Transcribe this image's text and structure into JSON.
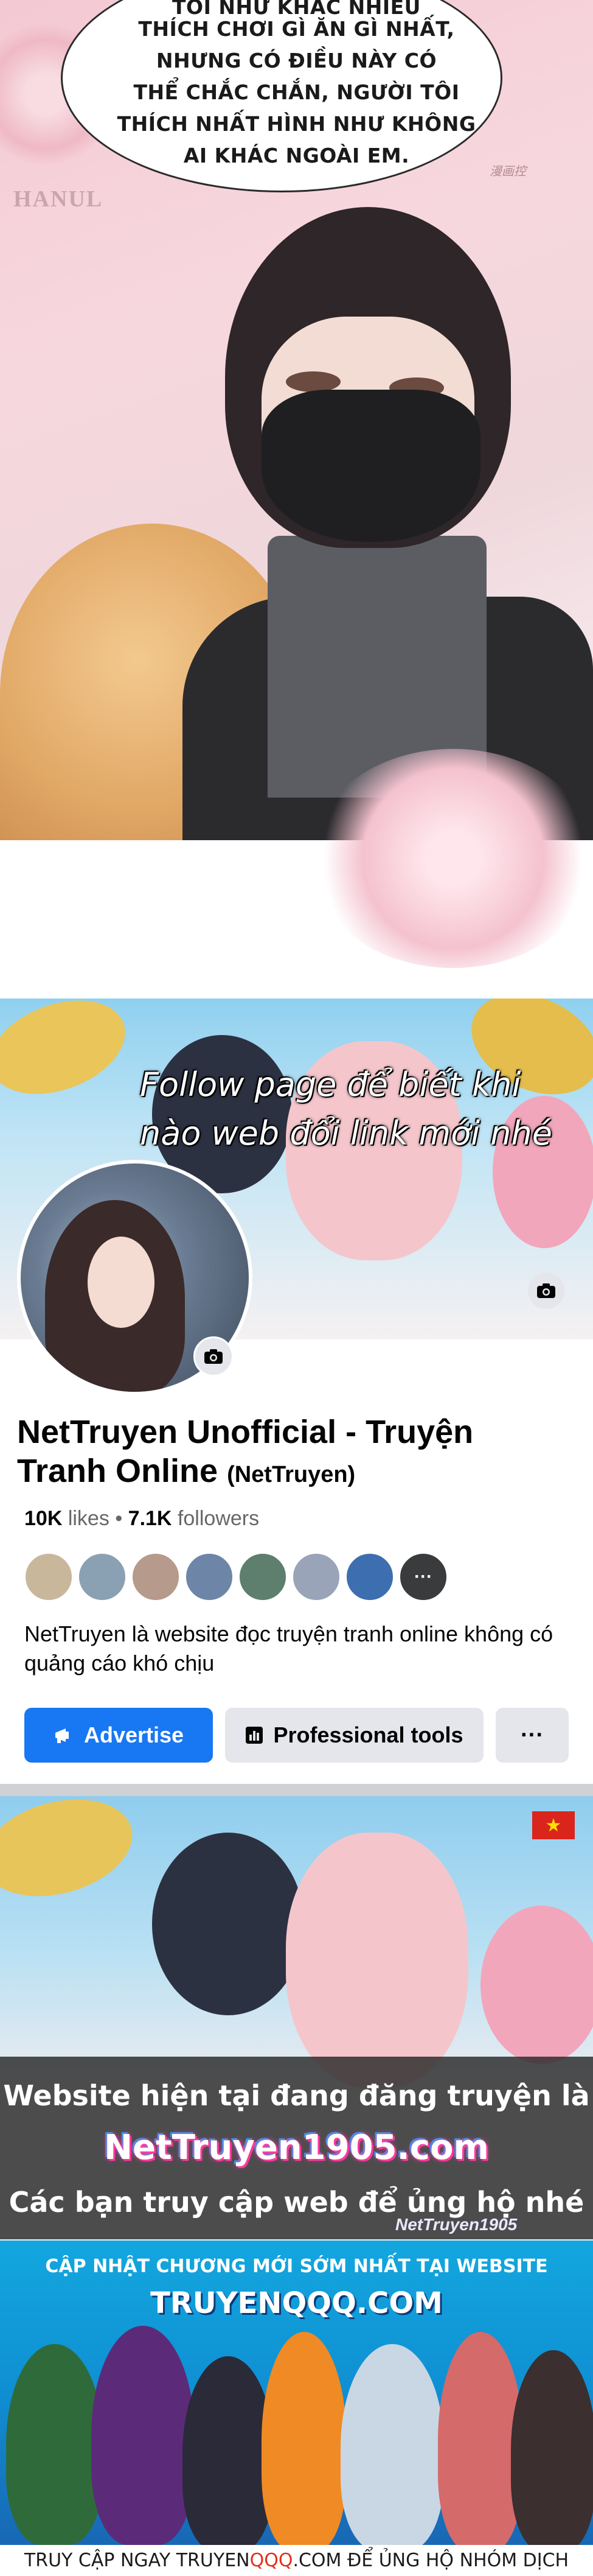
{
  "manga_panel": {
    "speech_lines": [
      "TÔI NHƯ KHÁC NHIỀU",
      "THÍCH CHƠI GÌ ĂN GÌ NHẤT,",
      "NHƯNG CÓ ĐIỀU NÀY CÓ",
      "THỂ CHẮC CHẮN, NGƯỜI TÔI",
      "THÍCH NHẤT HÌNH NHƯ KHÔNG",
      "AI KHÁC NGOÀI EM."
    ],
    "scanlator": "HANUL",
    "site_watermark": "漫画控"
  },
  "fb_page": {
    "cover_text": [
      "Follow page để biết khi",
      "nào web đổi link mới nhé"
    ],
    "name": "NetTruyen Unofficial - Truyện Tranh Online",
    "handle": "(NetTruyen)",
    "likes_count": "10K",
    "likes_label": "likes",
    "followers_count": "7.1K",
    "followers_label": "followers",
    "friend_colors": [
      "#c9b79c",
      "#8aa1b3",
      "#b69a8c",
      "#6d86a8",
      "#5f7f6e",
      "#9aa4b8",
      "#3d6fb0"
    ],
    "more_friends": "···",
    "about": "NetTruyen là website đọc truyện tranh online không có quảng cáo khó chịu",
    "advertise_label": "Advertise",
    "tools_label": "Professional tools",
    "more_label": "···",
    "accent": "#1877f2"
  },
  "banner": {
    "line1": "Website hiện tại đang đăng truyện là",
    "url": "NetTruyen1905.com",
    "line2": "Các bạn truy cập web để ủng hộ nhé",
    "watermark": "NetTruyen1905",
    "flag": "★"
  },
  "truyenqqq": {
    "top_text": "CẬP NHẬT CHƯƠNG MỚI SỚM NHẤT TẠI WEBSITE",
    "logo": "TRUYENQQQ.COM",
    "bottom_prefix": "TRUY CẬP NGAY TRUYEN",
    "bottom_highlight": "QQQ",
    "bottom_suffix": ".COM ĐỂ ỦNG HỘ NHÓM DỊCH"
  }
}
